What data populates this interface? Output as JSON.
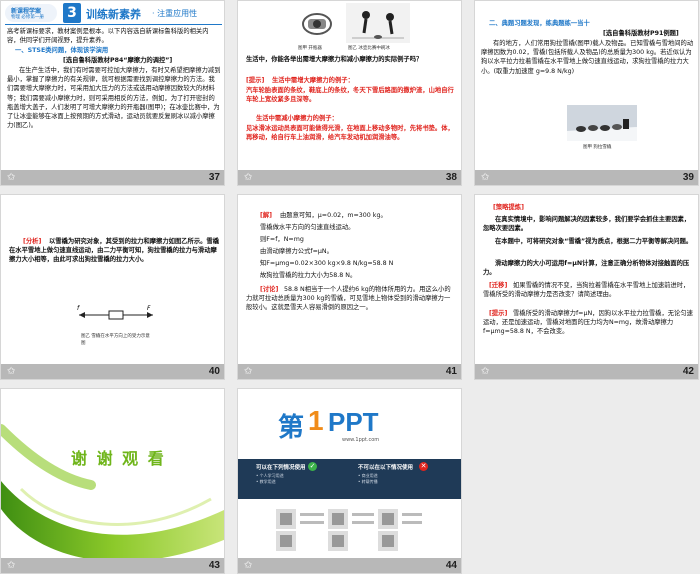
{
  "slides": {
    "s37": {
      "number": "37",
      "brand": "新课程学案",
      "brand_sub": "物理 必修第一册",
      "section_num": "3",
      "section_title": "训练新素养",
      "section_subtitle": "· 注重应用性",
      "intro": "高考新课标要求，教材案例是根本。以下内容选自新课标鲁科版的相关内容，供同学们开阔视野，提升素养。",
      "heading": "一、STSE类问题，体现该学演用",
      "source": "[选自鲁科版教材P84“摩擦力的调控”]",
      "body": "在生产生活中，我们有时需要可控加大摩擦力，有时又希望把摩擦力减到最小，掌握了摩擦力的有关规律，就可根据需要找到调控摩擦力的方法。我们需要增大摩擦力时，可采用加大压力的方法或选用动摩擦因数较大的材料等；我们需要减小摩擦力时，则可采用相反的方法，例如，为了打开密封的瓶盖增大盖子，人们发明了可增大摩擦力的开瓶器(图甲)；在冰壶比赛中，为了让冰壶能够在冰面上按预期的方式滑动，运动员就要反复刷冰以减小摩擦力(图乙)。"
    },
    "s38": {
      "number": "38",
      "caption_a": "图甲 开瓶器",
      "caption_b": "图乙 冰壶比赛中刷冰",
      "question": "生活中，你能各举出需增大摩擦力和减小摩擦力的实际例子吗？",
      "hint_label": "[提示]",
      "hint1": "生活中需增大摩擦力的例子：",
      "hint1_body": "汽车轮胎表面的条纹，鞋底上的条纹，冬天下雪后路面的撒炉渣，山地自行车轮上宽纹紧多且深等。",
      "hint2": "生活中需减小摩擦力的例子：",
      "hint2_body": "见冰滑冰运动员表面可能做得光滑，在地面上移动多物时，先将书垫。体，再移动，给自行车上油润滑，给汽车发动机加润滑油等。"
    },
    "s39": {
      "number": "39",
      "heading": "二、典题习题发现，练典题练一当十",
      "source": "[选自鲁科版教材P91例题]",
      "body": "有的地方，人们常用狗拉雪橇(图甲)载人及物品。已知雪橇与雪地间的动摩擦因数为0.02，雪橇(包括所载人及物品)的总质量为300 kg。若近似认为狗以水平拉力拉着雪橇在水平雪地上做匀速直线运动，求狗拉雪橇的拉力大小。(取重力加速度 g=9.8 N/kg)",
      "caption": "图甲 狗拉雪橇"
    },
    "s40": {
      "number": "40",
      "label": "[分析]",
      "body": "以雪橇为研究对象，其受到的拉力和摩擦力如图乙所示。雪橇在水平雪地上做匀速直线运动，由二力平衡可知，狗拉雪橇的拉力与滑动摩擦力大小相等，由此可求出狗拉雪橇的拉力大小。",
      "force_f": "f",
      "force_F": "F",
      "caption": "图乙 雪橇在水平方向上的受力示意图"
    },
    "s41": {
      "number": "41",
      "solve_label": "[解]",
      "solve": "由题意可知，μ=0.02，m=300 kg。",
      "l2": "雪橇做水平方向的匀速直线运动。",
      "l3": "则F=f，N=mg",
      "l4": "由滑动摩擦力公式f=μN。",
      "l5": "知F=μmg=0.02×300 kg×9.8 N/kg=58.8 N",
      "l6": "故狗拉雪橇的拉力大小为58.8 N。",
      "discuss_label": "[讨论]",
      "discuss": "58.8 N相当于一个人提约6 kg的物体所用的力。用这么小的力就可拉动总质量为300 kg的雪橇，可见雪地上物体受到的滑动摩擦力一般较小。这就是雪天人容易滑倒的原因之一。"
    },
    "s42": {
      "number": "42",
      "label": "[策略提炼]",
      "p1": "在真实情境中，影响问题解决的因素较多，我们要学会抓住主要因素，忽略次要因素。",
      "p2": "在本题中，可将研究对象“雪橇”视为质点，根据二力平衡等解决问题。",
      "p3": "滑动摩擦力的大小可运用f=μN计算，注意正确分析物体对接触面的压力。",
      "ext_label": "[迁移]",
      "ext": "如果雪橇的情况不变，当狗拉着雪橇在水平雪地上加速前进时，雪橇所受的滑动摩擦力是否改变？请简述理由。",
      "hint_label": "[提示]",
      "hint": "雪橇所受的滑动摩擦力f=μN，因狗以水平拉力拉雪橇，无论匀速运动，还是加速运动，雪橇对地面的压力均为N=mg，故滑动摩擦力f=μmg=58.8 N，不会改变。"
    },
    "s43": {
      "number": "43",
      "text": "谢 谢 观 看"
    },
    "s44": {
      "number": "44",
      "logo_prefix": "第",
      "logo_num": "1",
      "logo_suffix": "PPT",
      "logo_url": "www.1ppt.com",
      "ok_title": "可以在下列情况使用",
      "ok_body": "• 个人学习用途\n• 教学用途",
      "no_title": "不可以在以下情况使用",
      "no_body": "• 商业用途\n• 转载传播"
    }
  },
  "colors": {
    "accent_blue": "#1f78c8",
    "accent_red": "#e0241e",
    "thumb_bar": "#b8b8b8",
    "thanks_green": "#7dbf1f"
  }
}
